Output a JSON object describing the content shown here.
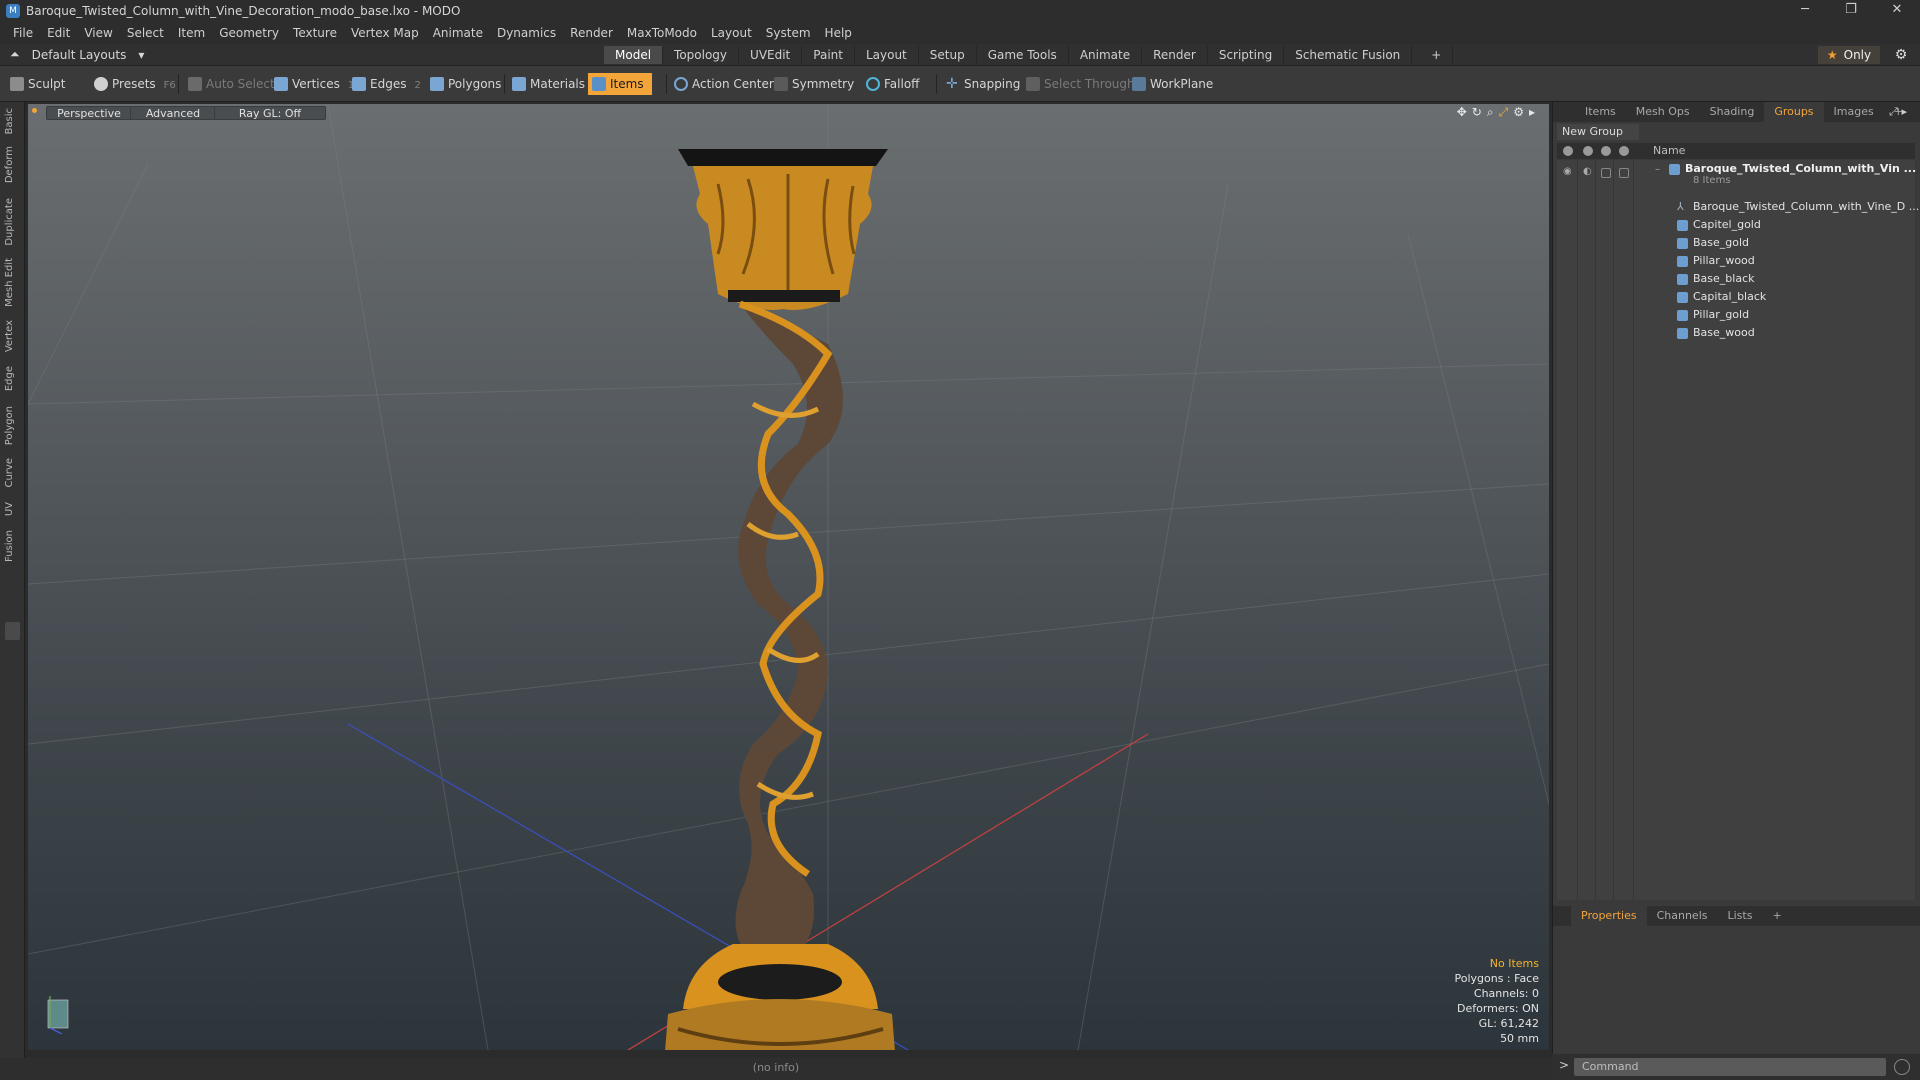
{
  "window": {
    "title": "Baroque_Twisted_Column_with_Vine_Decoration_modo_base.lxo - MODO",
    "controls": [
      "─",
      "❐",
      "✕"
    ]
  },
  "menu": [
    "File",
    "Edit",
    "View",
    "Select",
    "Item",
    "Geometry",
    "Texture",
    "Vertex Map",
    "Animate",
    "Dynamics",
    "Render",
    "MaxToModo",
    "Layout",
    "System",
    "Help"
  ],
  "layout": {
    "selector": "Default Layouts",
    "tabs": [
      "Model",
      "Topology",
      "UVEdit",
      "Paint",
      "Layout",
      "Setup",
      "Game Tools",
      "Animate",
      "Render",
      "Scripting",
      "Schematic Fusion"
    ],
    "active_tab": "Model",
    "only_label": "Only"
  },
  "toolbar": {
    "sculpt": "Sculpt",
    "presets": "Presets",
    "presets_key": "F6",
    "auto_select": "Auto Select",
    "vertices": "Vertices",
    "vertices_key": "1",
    "edges": "Edges",
    "edges_key": "2",
    "polygons": "Polygons",
    "materials": "Materials",
    "items": "Items",
    "action_center": "Action Center",
    "symmetry": "Symmetry",
    "falloff": "Falloff",
    "snapping": "Snapping",
    "select_through": "Select Through",
    "workplane": "WorkPlane"
  },
  "left_tabs": [
    "Basic",
    "Deform",
    "Duplicate",
    "Mesh Edit",
    "Vertex",
    "Edge",
    "Polygon",
    "Curve",
    "UV",
    "Fusion"
  ],
  "viewport": {
    "view_mode": "Perspective",
    "shading": "Advanced",
    "raygl": "Ray GL: Off",
    "info": {
      "selection": "No Items",
      "polygons": "Polygons : Face",
      "channels": "Channels: 0",
      "deformers": "Deformers: ON",
      "gl": "GL: 61,242",
      "grid": "50 mm"
    }
  },
  "right_panel": {
    "tabs": [
      "Items",
      "Mesh Ops",
      "Shading",
      "Groups",
      "Images"
    ],
    "active_tab": "Groups",
    "new_group": "New Group",
    "column_name": "Name",
    "group": {
      "name": "Baroque_Twisted_Column_with_Vin ...",
      "count": "8 Items"
    },
    "items": [
      "Baroque_Twisted_Column_with_Vine_D ...",
      "Capitel_gold",
      "Base_gold",
      "Pillar_wood",
      "Base_black",
      "Capital_black",
      "Pillar_gold",
      "Base_wood"
    ],
    "lower_tabs": [
      "Properties",
      "Channels",
      "Lists"
    ],
    "lower_active": "Properties"
  },
  "command": {
    "placeholder": "Command"
  },
  "status": {
    "text": "(no info)"
  },
  "colors": {
    "accent": "#f3a53a",
    "gold": "#d9921e",
    "column_wood": "#5a4535"
  }
}
